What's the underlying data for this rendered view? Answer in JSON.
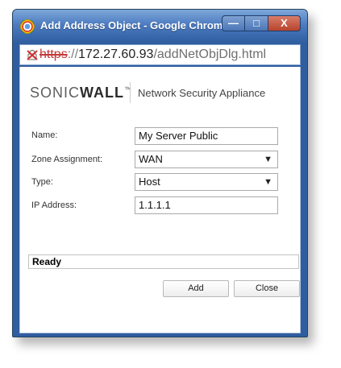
{
  "window": {
    "title": "Add Address Object - Google Chrome",
    "controls": {
      "minimize": "—",
      "maximize": "□",
      "close": "X"
    }
  },
  "address_bar": {
    "scheme": "https",
    "separator": "://",
    "host": "172.27.60.93",
    "path": "/addNetObjDlg.html",
    "warning_icon": "insecure-https-icon"
  },
  "brand": {
    "name_regular": "SONIC",
    "name_bold": "WALL",
    "trademark": "™",
    "product": "Network Security Appliance"
  },
  "form": {
    "name_label": "Name:",
    "name_value": "My Server Public",
    "zone_label": "Zone Assignment:",
    "zone_value": "WAN",
    "type_label": "Type:",
    "type_value": "Host",
    "ip_label": "IP Address:",
    "ip_value": "1.1.1.1",
    "dropdown_arrow": "▼"
  },
  "status": {
    "text": "Ready"
  },
  "buttons": {
    "add": "Add",
    "close": "Close"
  },
  "colors": {
    "titlebar": "#4c7bc0",
    "close_control": "#b8432c",
    "insecure_scheme": "#c43a3a"
  }
}
